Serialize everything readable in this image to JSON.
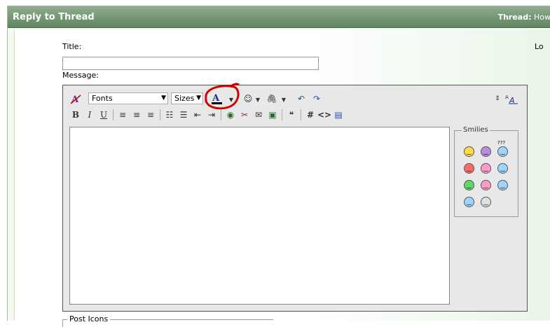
{
  "header": {
    "title": "Reply to Thread",
    "thread_label": "Thread:",
    "thread_value": "How"
  },
  "form": {
    "title_label": "Title:",
    "title_value": "",
    "message_label": "Message:",
    "side_label": "Lo"
  },
  "toolbar": {
    "font_select": "Fonts",
    "size_select": "Sizes",
    "row1_icons": [
      "remove-format-icon",
      "font-color-icon",
      "smiley-icon",
      "attachment-icon",
      "undo-icon",
      "redo-icon",
      "resize-icon",
      "switch-mode-icon"
    ],
    "row2_icons": [
      "bold-icon",
      "italic-icon",
      "underline-icon",
      "align-left-icon",
      "align-center-icon",
      "align-right-icon",
      "ordered-list-icon",
      "unordered-list-icon",
      "outdent-icon",
      "indent-icon",
      "link-icon",
      "unlink-icon",
      "email-icon",
      "image-icon",
      "quote-icon",
      "hash-icon",
      "code-icon",
      "php-icon"
    ]
  },
  "smilies": {
    "legend": "Smilies",
    "items": [
      {
        "name": "smile",
        "color": "#ffd84a"
      },
      {
        "name": "frown",
        "color": "#b98ce0"
      },
      {
        "name": "confused",
        "color": "#9fd4ff",
        "label": "???"
      },
      {
        "name": "mad",
        "color": "#ff6a6a"
      },
      {
        "name": "redface",
        "color": "#ff9cc8"
      },
      {
        "name": "wink",
        "color": "#9fd4ff"
      },
      {
        "name": "biggrin",
        "color": "#62d862"
      },
      {
        "name": "tongue",
        "color": "#ff9cc8"
      },
      {
        "name": "rolleyes",
        "color": "#9fd4ff"
      },
      {
        "name": "cool",
        "color": "#9fd4ff"
      },
      {
        "name": "eek",
        "color": "#e0e0e0"
      }
    ]
  },
  "post_icons": {
    "label": "Post Icons"
  }
}
